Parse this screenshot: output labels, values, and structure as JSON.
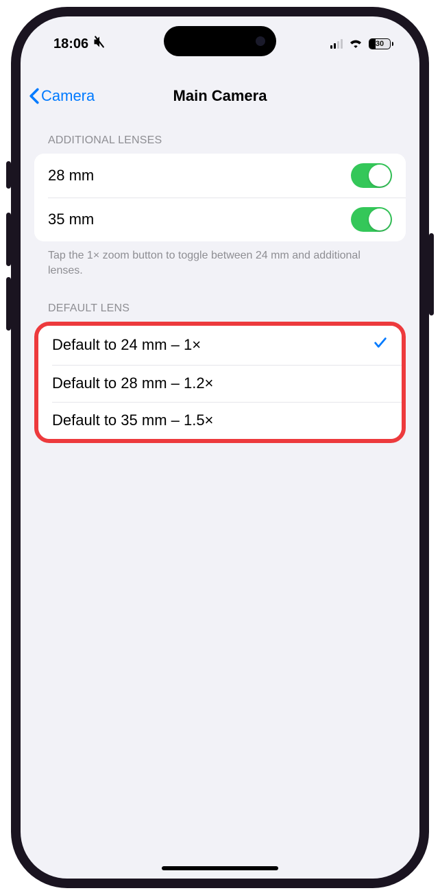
{
  "status": {
    "time": "18:06",
    "battery_pct": "30"
  },
  "nav": {
    "back_label": "Camera",
    "title": "Main Camera"
  },
  "sections": {
    "additional_lenses": {
      "header": "Additional Lenses",
      "rows": [
        {
          "label": "28 mm",
          "enabled": true
        },
        {
          "label": "35 mm",
          "enabled": true
        }
      ],
      "footer": "Tap the 1× zoom button to toggle between 24 mm and additional lenses."
    },
    "default_lens": {
      "header": "Default Lens",
      "rows": [
        {
          "label": "Default to 24 mm – 1×",
          "selected": true
        },
        {
          "label": "Default to 28 mm – 1.2×",
          "selected": false
        },
        {
          "label": "Default to 35 mm – 1.5×",
          "selected": false
        }
      ]
    }
  }
}
